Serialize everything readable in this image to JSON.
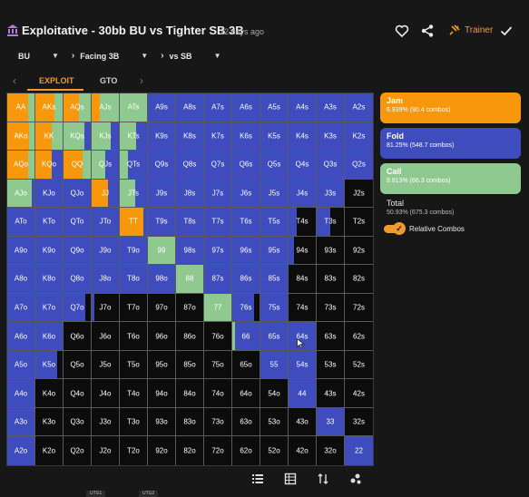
{
  "header": {
    "title": "Exploitative - 30bb BU vs Tighter SB 3B",
    "time_ago": "12 days ago",
    "trainer_label": "Trainer"
  },
  "breadcrumbs": [
    {
      "label": "BU"
    },
    {
      "label": "Facing 3B"
    },
    {
      "label": "vs SB"
    }
  ],
  "tabs": {
    "exploit": "EXPLOIT",
    "gto": "GTO"
  },
  "colors": {
    "jam": "#f7980c",
    "fold": "#3f4cbd",
    "call": "#90c98f",
    "none": "#0f0f0f"
  },
  "legend": [
    {
      "name": "Jam",
      "detail": "6.939% (90.4 combos)",
      "color": "#f7980c"
    },
    {
      "name": "Fold",
      "detail": "81.25% (548.7 combos)",
      "color": "#3f4cbd"
    },
    {
      "name": "Call",
      "detail": "9.813% (66.3 combos)",
      "color": "#90c98f"
    }
  ],
  "total": {
    "label": "Total",
    "detail": "50.93% (675.3 combos)"
  },
  "toggle": {
    "label": "Relative Combos",
    "on": true
  },
  "footer_tabs": [
    "UTG1",
    "UTG2"
  ],
  "matrix": {
    "rows": [
      [
        "AA",
        "AKs",
        "AQs",
        "AJs",
        "ATs",
        "A9s",
        "A8s",
        "A7s",
        "A6s",
        "A5s",
        "A4s",
        "A3s",
        "A2s"
      ],
      [
        "AKo",
        "KK",
        "KQs",
        "KJs",
        "KTs",
        "K9s",
        "K8s",
        "K7s",
        "K6s",
        "K5s",
        "K4s",
        "K3s",
        "K2s"
      ],
      [
        "AQo",
        "KQo",
        "QQ",
        "QJs",
        "QTs",
        "Q9s",
        "Q8s",
        "Q7s",
        "Q6s",
        "Q5s",
        "Q4s",
        "Q3s",
        "Q2s"
      ],
      [
        "AJo",
        "KJo",
        "QJo",
        "JJ",
        "JTs",
        "J9s",
        "J8s",
        "J7s",
        "J6s",
        "J5s",
        "J4s",
        "J3s",
        "J2s"
      ],
      [
        "ATo",
        "KTo",
        "QTo",
        "JTo",
        "TT",
        "T9s",
        "T8s",
        "T7s",
        "T6s",
        "T5s",
        "T4s",
        "T3s",
        "T2s"
      ],
      [
        "A9o",
        "K9o",
        "Q9o",
        "J9o",
        "T9o",
        "99",
        "98s",
        "97s",
        "96s",
        "95s",
        "94s",
        "93s",
        "92s"
      ],
      [
        "A8o",
        "K8o",
        "Q8o",
        "J8o",
        "T8o",
        "98o",
        "88",
        "87s",
        "86s",
        "85s",
        "84s",
        "83s",
        "82s"
      ],
      [
        "A7o",
        "K7o",
        "Q7o",
        "J7o",
        "T7o",
        "97o",
        "87o",
        "77",
        "76s",
        "75s",
        "74s",
        "73s",
        "72s"
      ],
      [
        "A6o",
        "K6o",
        "Q6o",
        "J6o",
        "T6o",
        "96o",
        "86o",
        "76o",
        "66",
        "65s",
        "64s",
        "63s",
        "62s"
      ],
      [
        "A5o",
        "K5o",
        "Q5o",
        "J5o",
        "T5o",
        "95o",
        "85o",
        "75o",
        "65o",
        "55",
        "54s",
        "53s",
        "52s"
      ],
      [
        "A4o",
        "K4o",
        "Q4o",
        "J4o",
        "T4o",
        "94o",
        "84o",
        "74o",
        "64o",
        "54o",
        "44",
        "43s",
        "42s"
      ],
      [
        "A3o",
        "K3o",
        "Q3o",
        "J3o",
        "T3o",
        "93o",
        "83o",
        "73o",
        "63o",
        "53o",
        "43o",
        "33",
        "32s"
      ],
      [
        "A2o",
        "K2o",
        "Q2o",
        "J2o",
        "T2o",
        "92o",
        "82o",
        "72o",
        "62o",
        "52o",
        "42o",
        "32o",
        "22"
      ]
    ],
    "strategies": [
      [
        [
          0.78,
          0.22,
          0
        ],
        [
          0.7,
          0.3,
          0
        ],
        [
          0.55,
          0.45,
          0
        ],
        [
          0.3,
          0.7,
          0
        ],
        [
          0,
          1,
          0
        ],
        [
          0,
          0,
          1
        ],
        [
          0,
          0,
          1
        ],
        [
          0,
          0,
          1
        ],
        [
          0,
          0,
          1
        ],
        [
          0,
          0,
          1
        ],
        [
          0,
          0,
          1
        ],
        [
          0,
          0,
          1
        ],
        [
          0,
          0,
          1
        ]
      ],
      [
        [
          0.8,
          0.2,
          0
        ],
        [
          0.6,
          0.4,
          0
        ],
        [
          0,
          0.75,
          0.25
        ],
        [
          0,
          0.7,
          0.3
        ],
        [
          0,
          0.6,
          0.4
        ],
        [
          0,
          0,
          1
        ],
        [
          0,
          0,
          1
        ],
        [
          0,
          0,
          1
        ],
        [
          0,
          0,
          1
        ],
        [
          0,
          0,
          1
        ],
        [
          0,
          0,
          1
        ],
        [
          0,
          0,
          1
        ],
        [
          0,
          0,
          1
        ]
      ],
      [
        [
          0.75,
          0.25,
          0
        ],
        [
          0.6,
          0,
          0.4
        ],
        [
          0.7,
          0.3,
          0
        ],
        [
          0,
          0.5,
          0.5
        ],
        [
          0,
          0.3,
          0.7
        ],
        [
          0,
          0,
          1
        ],
        [
          0,
          0,
          1
        ],
        [
          0,
          0,
          1
        ],
        [
          0,
          0,
          1
        ],
        [
          0,
          0,
          1
        ],
        [
          0,
          0,
          1
        ],
        [
          0,
          0,
          1
        ],
        [
          0,
          0,
          1
        ]
      ],
      [
        [
          0,
          0.9,
          0.1
        ],
        [
          0,
          0,
          1
        ],
        [
          0,
          0,
          1
        ],
        [
          0.6,
          0,
          0.4
        ],
        [
          0,
          0.55,
          0.45
        ],
        [
          0,
          0,
          1
        ],
        [
          0,
          0,
          1
        ],
        [
          0,
          0,
          1
        ],
        [
          0,
          0,
          1
        ],
        [
          0,
          0,
          1
        ],
        [
          0,
          0,
          1
        ],
        [
          0,
          0,
          1
        ],
        [
          0,
          0,
          0
        ]
      ],
      [
        [
          0,
          0,
          1
        ],
        [
          0,
          0,
          1
        ],
        [
          0,
          0,
          1
        ],
        [
          0,
          0,
          1
        ],
        [
          0.85,
          0,
          0.15
        ],
        [
          0,
          0,
          1
        ],
        [
          0,
          0,
          1
        ],
        [
          0,
          0,
          1
        ],
        [
          0,
          0,
          1
        ],
        [
          0,
          0,
          1
        ],
        [
          0,
          0,
          0.3
        ],
        [
          0,
          0,
          0.5
        ],
        [
          0,
          0,
          0
        ]
      ],
      [
        [
          0,
          0,
          1
        ],
        [
          0,
          0,
          1
        ],
        [
          0,
          0,
          1
        ],
        [
          0,
          0,
          1
        ],
        [
          0,
          0,
          1
        ],
        [
          0,
          1,
          0
        ],
        [
          0,
          0,
          1
        ],
        [
          0,
          0,
          1
        ],
        [
          0,
          0,
          1
        ],
        [
          0,
          0,
          1
        ],
        [
          0,
          0,
          0.2
        ],
        [
          0,
          0,
          0
        ],
        [
          0,
          0,
          0
        ]
      ],
      [
        [
          0,
          0,
          1
        ],
        [
          0,
          0,
          1
        ],
        [
          0,
          0,
          1
        ],
        [
          0,
          0,
          1
        ],
        [
          0,
          0,
          1
        ],
        [
          0,
          0,
          1
        ],
        [
          0,
          1,
          0
        ],
        [
          0,
          0,
          1
        ],
        [
          0,
          0,
          1
        ],
        [
          0,
          0,
          1
        ],
        [
          0,
          0,
          0
        ],
        [
          0,
          0,
          0
        ],
        [
          0,
          0,
          0
        ]
      ],
      [
        [
          0,
          0,
          1
        ],
        [
          0,
          0,
          1
        ],
        [
          0,
          0,
          0.8
        ],
        [
          0,
          0,
          0.1
        ],
        [
          0,
          0,
          0
        ],
        [
          0,
          0,
          0
        ],
        [
          0,
          0,
          0
        ],
        [
          0,
          1,
          0
        ],
        [
          0,
          0,
          0.8
        ],
        [
          0,
          0,
          1
        ],
        [
          0,
          0,
          0
        ],
        [
          0,
          0,
          0
        ],
        [
          0,
          0,
          0
        ]
      ],
      [
        [
          0,
          0,
          1
        ],
        [
          0,
          0,
          1
        ],
        [
          0,
          0,
          0
        ],
        [
          0,
          0,
          0
        ],
        [
          0,
          0,
          0
        ],
        [
          0,
          0,
          0
        ],
        [
          0,
          0,
          0
        ],
        [
          0,
          0,
          0
        ],
        [
          0,
          0.1,
          0.9
        ],
        [
          0,
          0,
          1
        ],
        [
          0,
          0,
          1
        ],
        [
          0,
          0,
          0
        ],
        [
          0,
          0,
          0
        ]
      ],
      [
        [
          0,
          0,
          1
        ],
        [
          0,
          0,
          0.8
        ],
        [
          0,
          0,
          0
        ],
        [
          0,
          0,
          0
        ],
        [
          0,
          0,
          0
        ],
        [
          0,
          0,
          0
        ],
        [
          0,
          0,
          0
        ],
        [
          0,
          0,
          0
        ],
        [
          0,
          0,
          0
        ],
        [
          0,
          0,
          1
        ],
        [
          0,
          0,
          1
        ],
        [
          0,
          0,
          0
        ],
        [
          0,
          0,
          0
        ]
      ],
      [
        [
          0,
          0,
          1
        ],
        [
          0,
          0,
          0
        ],
        [
          0,
          0,
          0
        ],
        [
          0,
          0,
          0
        ],
        [
          0,
          0,
          0
        ],
        [
          0,
          0,
          0
        ],
        [
          0,
          0,
          0
        ],
        [
          0,
          0,
          0
        ],
        [
          0,
          0,
          0
        ],
        [
          0,
          0,
          0
        ],
        [
          0,
          0,
          1
        ],
        [
          0,
          0,
          0
        ],
        [
          0,
          0,
          0
        ]
      ],
      [
        [
          0,
          0,
          1
        ],
        [
          0,
          0,
          0
        ],
        [
          0,
          0,
          0
        ],
        [
          0,
          0,
          0
        ],
        [
          0,
          0,
          0
        ],
        [
          0,
          0,
          0
        ],
        [
          0,
          0,
          0
        ],
        [
          0,
          0,
          0
        ],
        [
          0,
          0,
          0
        ],
        [
          0,
          0,
          0
        ],
        [
          0,
          0,
          0
        ],
        [
          0,
          0,
          1
        ],
        [
          0,
          0,
          0
        ]
      ],
      [
        [
          0,
          0,
          1
        ],
        [
          0,
          0,
          0
        ],
        [
          0,
          0,
          0
        ],
        [
          0,
          0,
          0
        ],
        [
          0,
          0,
          0
        ],
        [
          0,
          0,
          0
        ],
        [
          0,
          0,
          0
        ],
        [
          0,
          0,
          0
        ],
        [
          0,
          0,
          0
        ],
        [
          0,
          0,
          0
        ],
        [
          0,
          0,
          0
        ],
        [
          0,
          0,
          0
        ],
        [
          0,
          0,
          1
        ]
      ]
    ]
  },
  "icons": {
    "bank": "bank-icon",
    "favorite": "heart-icon",
    "share": "share-icon",
    "trainer": "trainer-icon",
    "confirm": "check-icon",
    "tools": [
      "list-icon",
      "table-icon",
      "sort-icon",
      "scatter-icon"
    ]
  }
}
